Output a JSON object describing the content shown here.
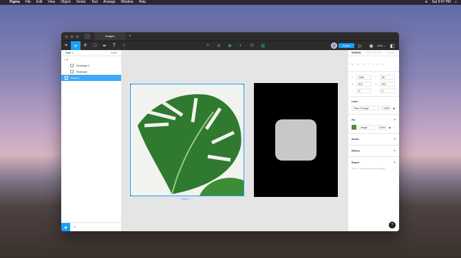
{
  "menubar": {
    "items": [
      "Figma",
      "File",
      "Edit",
      "View",
      "Object",
      "Vector",
      "Text",
      "Arrange",
      "Window",
      "Help"
    ],
    "clock": "Sat 9:47 PM"
  },
  "titlebar": {
    "tab_label": "Images",
    "new_tab": "+"
  },
  "toolbar": {
    "share_label": "Share",
    "zoom_label": "63% ⌄"
  },
  "left_panel": {
    "page_label": "Page 1",
    "page_count": "1 of 2",
    "layers": [
      {
        "label": "Rectangle 2"
      },
      {
        "label": "Rectangle"
      },
      {
        "label": "Frame 1"
      }
    ]
  },
  "canvas": {
    "frame_label": "Frame 1"
  },
  "right_panel": {
    "tabs": [
      "DESIGN",
      "PROTOTYPE",
      "CODE"
    ],
    "props": [
      {
        "key": "X",
        "value": "1368"
      },
      {
        "key": "Y",
        "value": "86"
      },
      {
        "key": "W",
        "value": "813"
      },
      {
        "key": "H",
        "value": "813"
      },
      {
        "key": "°",
        "value": "0°"
      },
      {
        "key": "⌜",
        "value": "0"
      }
    ],
    "layer_title": "Layer",
    "blend_mode": "Pass Through",
    "layer_opacity": "100%",
    "fill_title": "Fill",
    "fill_type": "Image",
    "fill_opacity": "100%",
    "stroke_title": "Stroke",
    "effects_title": "Effects",
    "export_title": "Export",
    "export_hint": "Click + to add an export setting"
  }
}
